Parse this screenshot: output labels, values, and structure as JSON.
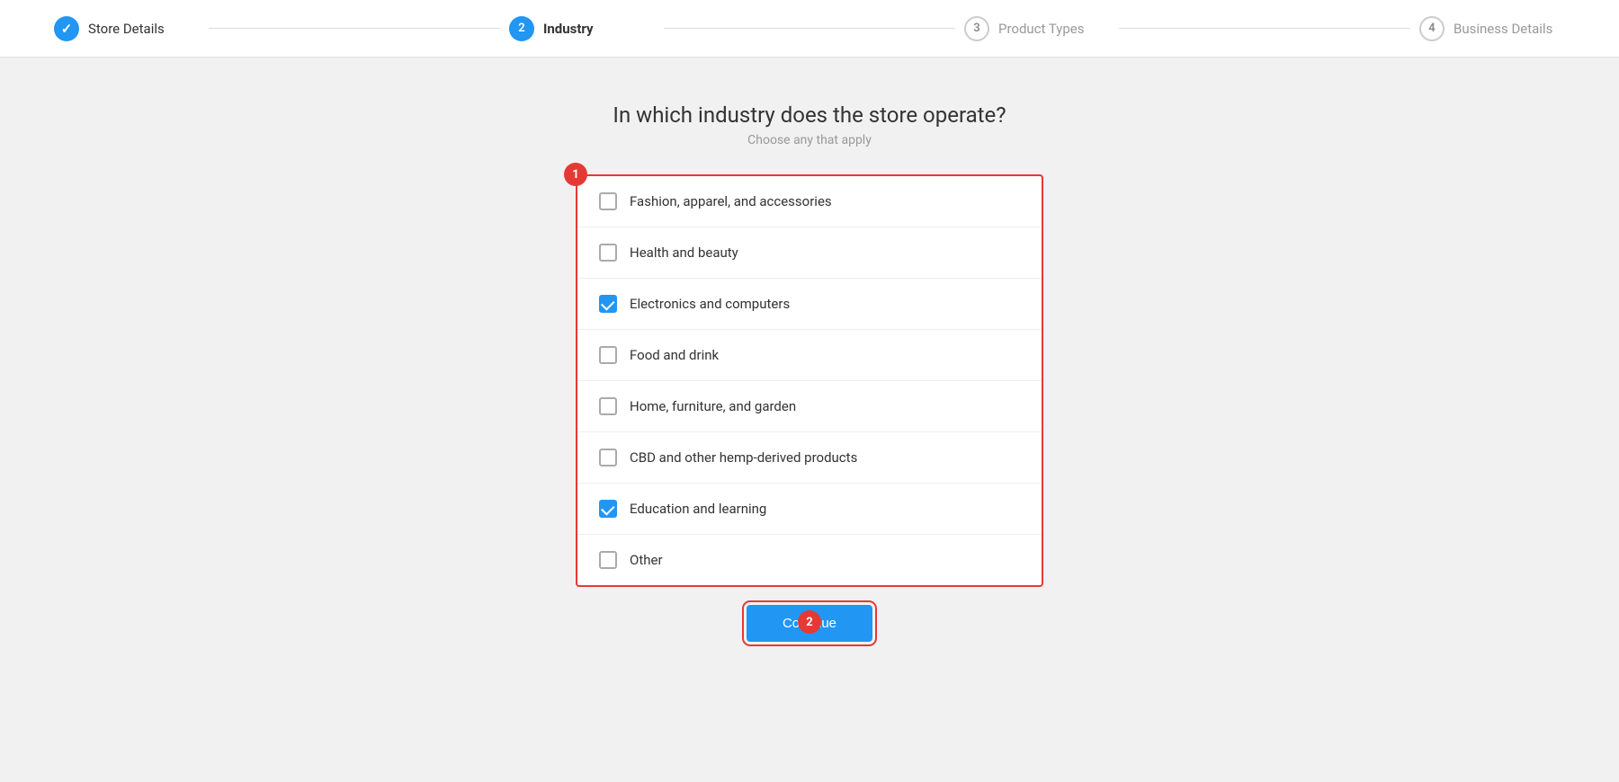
{
  "stepper": {
    "steps": [
      {
        "id": "store-details",
        "number": "✓",
        "label": "Store Details",
        "state": "done"
      },
      {
        "id": "industry",
        "number": "2",
        "label": "Industry",
        "state": "active"
      },
      {
        "id": "product-types",
        "number": "3",
        "label": "Product Types",
        "state": "inactive"
      },
      {
        "id": "business-details",
        "number": "4",
        "label": "Business Details",
        "state": "inactive"
      }
    ]
  },
  "page": {
    "title": "In which industry does the store operate?",
    "subtitle": "Choose any that apply"
  },
  "industries": [
    {
      "id": "fashion",
      "label": "Fashion, apparel, and accessories",
      "checked": false
    },
    {
      "id": "health",
      "label": "Health and beauty",
      "checked": false
    },
    {
      "id": "electronics",
      "label": "Electronics and computers",
      "checked": true
    },
    {
      "id": "food",
      "label": "Food and drink",
      "checked": false
    },
    {
      "id": "home",
      "label": "Home, furniture, and garden",
      "checked": false
    },
    {
      "id": "cbd",
      "label": "CBD and other hemp-derived products",
      "checked": false
    },
    {
      "id": "education",
      "label": "Education and learning",
      "checked": true
    },
    {
      "id": "other",
      "label": "Other",
      "checked": false
    }
  ],
  "annotations": {
    "badge1": "1",
    "badge2": "2"
  },
  "buttons": {
    "continue": "Continue"
  }
}
